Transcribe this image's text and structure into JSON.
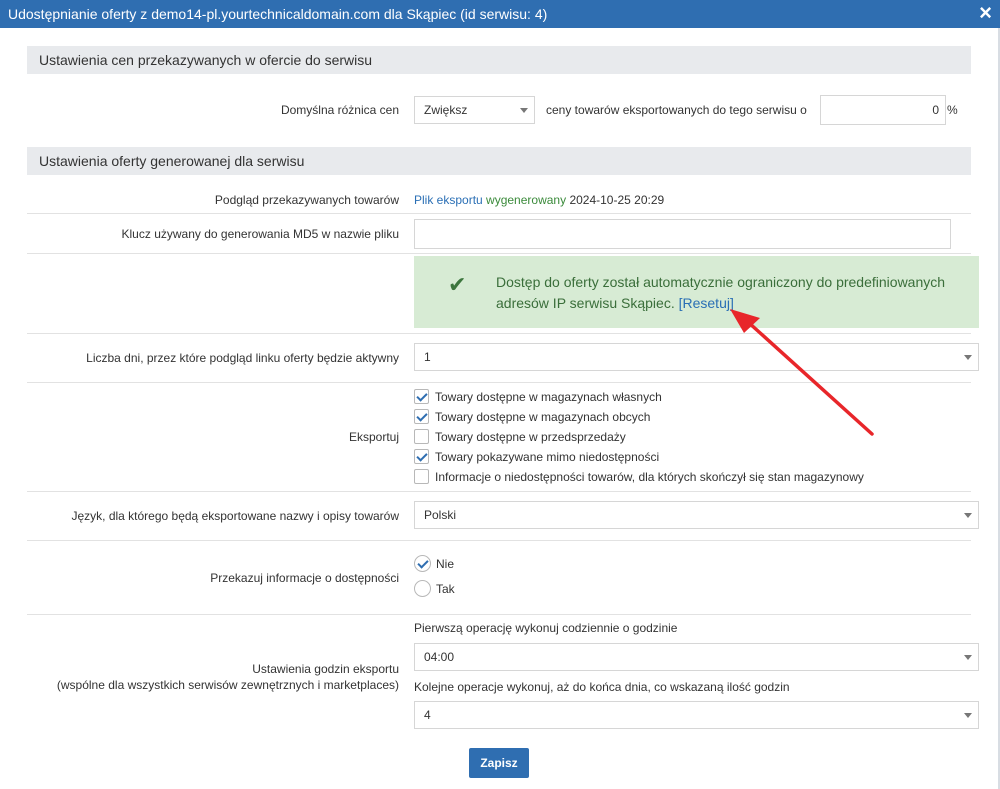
{
  "window": {
    "title": "Udostępnianie oferty z demo14-pl.yourtechnicaldomain.com dla Skąpiec (id serwisu: 4)",
    "close_icon": "×"
  },
  "sections": {
    "prices_title": "Ustawienia cen przekazywanych w ofercie do serwisu",
    "offer_title": "Ustawienia oferty generowanej dla serwisu"
  },
  "price_row": {
    "label": "Domyślna różnica cen",
    "direction_value": "Zwiększ",
    "middle_text": "ceny towarów eksportowanych do tego serwisu o",
    "percent_value": "0",
    "percent_suffix": "%"
  },
  "preview_row": {
    "label": "Podgląd przekazywanych towarów",
    "link_text": "Plik eksportu",
    "status_text": "wygenerowany",
    "timestamp": "2024-10-25 20:29"
  },
  "md5_row": {
    "label": "Klucz używany do generowania MD5 w nazwie pliku",
    "value": ""
  },
  "notice": {
    "text": "Dostęp do oferty został automatycznie ograniczony do predefiniowanych adresów IP serwisu Skąpiec. ",
    "link_open": "[",
    "link_text": "Resetuj",
    "link_close": "]",
    "color": "#d7ebd4"
  },
  "days_row": {
    "label": "Liczba dni, przez które podgląd linku oferty będzie aktywny",
    "value": "1"
  },
  "export_row": {
    "label": "Eksportuj",
    "options": [
      {
        "label": "Towary dostępne w magazynach własnych",
        "checked": true
      },
      {
        "label": "Towary dostępne w magazynach obcych",
        "checked": true
      },
      {
        "label": "Towary dostępne w przedsprzedaży",
        "checked": false
      },
      {
        "label": "Towary pokazywane mimo niedostępności",
        "checked": true
      },
      {
        "label": "Informacje o niedostępności towarów, dla których skończył się stan magazynowy",
        "checked": false
      }
    ]
  },
  "language_row": {
    "label": "Język, dla którego będą eksportowane nazwy i opisy towarów",
    "value": "Polski"
  },
  "availability_row": {
    "label": "Przekazuj informacje o dostępności",
    "options": [
      {
        "label": "Nie",
        "checked": true
      },
      {
        "label": "Tak",
        "checked": false
      }
    ]
  },
  "hours_row": {
    "label_line1": "Ustawienia godzin eksportu",
    "label_line2": "(wspólne dla wszystkich serwisów zewnętrznych i marketplaces)",
    "first_label": "Pierwszą operację wykonuj codziennie o godzinie",
    "first_value": "04:00",
    "next_label": "Kolejne operacje wykonuj, aż do końca dnia, co wskazaną ilość godzin",
    "next_value": "4"
  },
  "save_button": "Zapisz",
  "colors": {
    "accent": "#2f6eb1",
    "arrow": "#e8262a"
  }
}
